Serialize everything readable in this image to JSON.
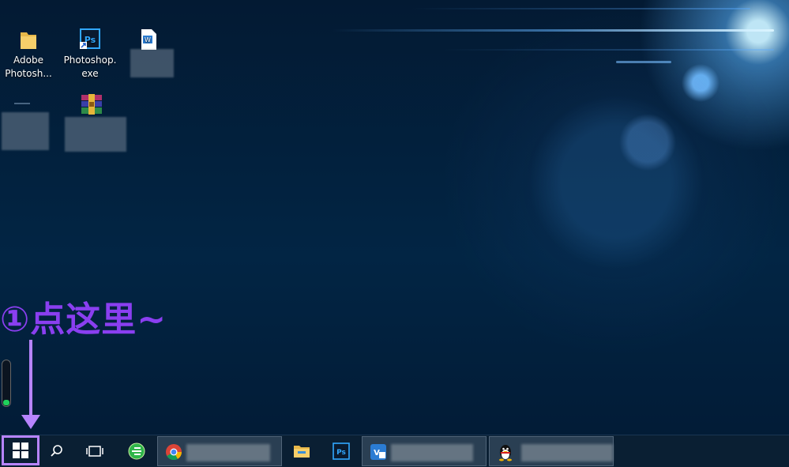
{
  "desktop": {
    "icons": [
      {
        "label": "Adobe Photosh...",
        "icon": "folder-icon"
      },
      {
        "label": "Photoshop.exe",
        "icon": "photoshop-shortcut-icon"
      },
      {
        "label": "",
        "icon": "word-document-icon"
      },
      {
        "label": "",
        "icon": "generic-file-icon"
      },
      {
        "label": "",
        "icon": "winrar-archive-icon"
      }
    ]
  },
  "annotation": {
    "text": "①点这里~",
    "color": "#8a3ff0"
  },
  "taskbar": {
    "items": [
      {
        "name": "start",
        "icon": "windows-logo-icon"
      },
      {
        "name": "search",
        "icon": "search-icon"
      },
      {
        "name": "task-view",
        "icon": "task-view-icon"
      },
      {
        "name": "browser-360",
        "icon": "360-browser-icon"
      },
      {
        "name": "chrome",
        "icon": "chrome-icon"
      },
      {
        "name": "file-explorer",
        "icon": "folder-icon"
      },
      {
        "name": "photoshop",
        "icon": "photoshop-icon"
      },
      {
        "name": "app-vh",
        "icon": "app-icon"
      },
      {
        "name": "qq",
        "icon": "qq-penguin-icon"
      }
    ],
    "highlight_color": "#b784ff"
  }
}
